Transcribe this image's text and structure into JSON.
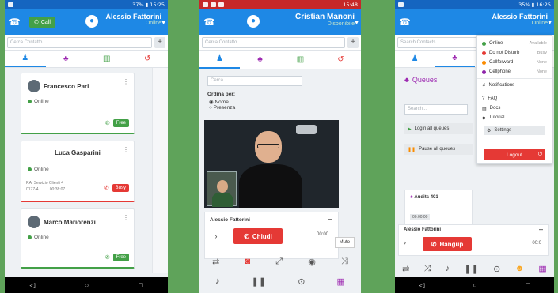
{
  "phone1": {
    "status_time": "37% ▮ 15:25",
    "call_label": "Call",
    "user_name": "Alessio Fattorini",
    "user_status": "Online",
    "search_placeholder": "Cerca Contatto...",
    "cards": [
      {
        "name": "Francesco Pari",
        "status": "Online",
        "btn": "Free"
      },
      {
        "name": "Luca Gasparini",
        "status": "Online",
        "btn": "Busy",
        "queue": "RAI Servizio Clienti",
        "queue_num": "4",
        "queue_sub": "0177‑4...",
        "time": "00:38:07"
      },
      {
        "name": "Marco Mariorenzi",
        "status": "Online",
        "btn": "Free"
      }
    ]
  },
  "phone2": {
    "status_time": "15:48",
    "user_name": "Cristian Manoni",
    "user_status": "Disponibile",
    "search_placeholder": "Cerca Contatto...",
    "filter_placeholder": "Cerca...",
    "order_label": "Ordina per:",
    "order_opt1": "Nome",
    "order_opt2": "Presenza",
    "caller": "Alessio Fattorini",
    "close_btn": "Chiudi",
    "timer": "00:00",
    "tooltip": "Muto"
  },
  "phone3": {
    "status_time": "35% ▮ 16:25",
    "user_name": "Alessio Fattorini",
    "user_status": "Online",
    "search_placeholder": "Search Contacts...",
    "queues_title": "Queues",
    "queue_search": "Search...",
    "login_all": "Login all queues",
    "pause_all": "Pause all queues",
    "queue_item": "Audits 401",
    "queue_time": "00:00:00",
    "caller": "Alessio Fattorini",
    "hangup": "Hangup",
    "timer": "00:0",
    "menu": [
      {
        "label": "Online",
        "ext": "Available",
        "color": "#43a047"
      },
      {
        "label": "Do not Disturb",
        "ext": "Busy",
        "color": "#e53935"
      },
      {
        "label": "Callforward",
        "ext": "None",
        "color": "#fb8c00"
      },
      {
        "label": "Cellphone",
        "ext": "None",
        "color": "#8e24aa"
      }
    ],
    "notifications": "Notifications",
    "faq": "FAQ",
    "docs": "Docs",
    "tutorial": "Tutorial",
    "settings": "Settings",
    "logout": "Logout"
  }
}
